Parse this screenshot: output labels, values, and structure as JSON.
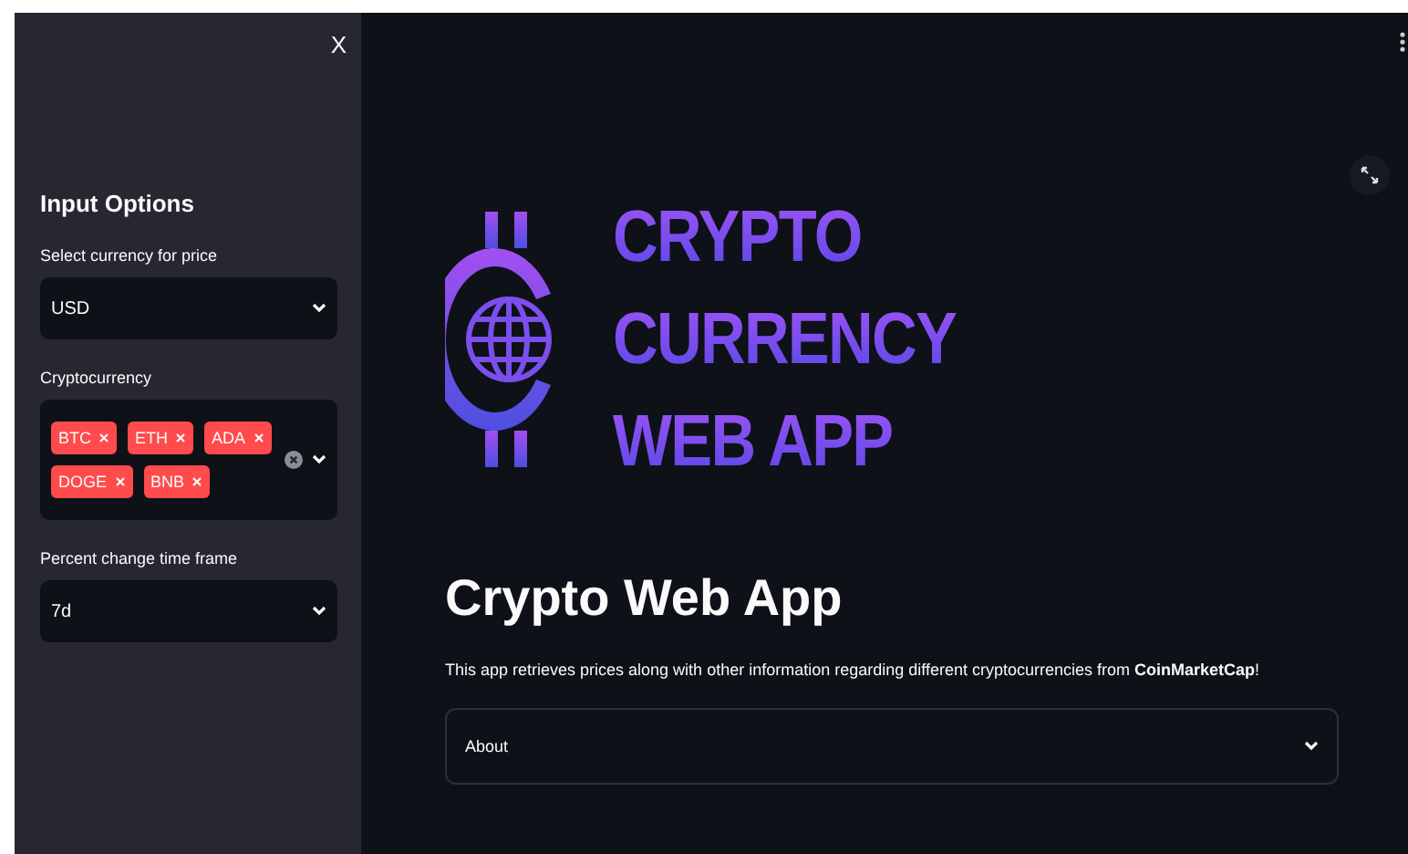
{
  "sidebar": {
    "close_icon": "X",
    "heading": "Input Options",
    "controls": [
      {
        "kind": "select",
        "label": "Select currency for price",
        "value": "USD"
      },
      {
        "kind": "multiselect",
        "label": "Cryptocurrency",
        "tags": [
          "BTC",
          "ETH",
          "ADA",
          "DOGE",
          "BNB"
        ]
      },
      {
        "kind": "select",
        "label": "Percent change time frame",
        "value": "7d"
      }
    ]
  },
  "main": {
    "logo_lines": [
      "CRYPTO",
      "CURRENCY",
      "WEB APP"
    ],
    "title": "Crypto Web App",
    "intro": "This app retrieves prices along with other information regarding different cryptocurrencies from **CoinMarketCap**!",
    "expander": {
      "label": "About",
      "expanded": false
    }
  }
}
